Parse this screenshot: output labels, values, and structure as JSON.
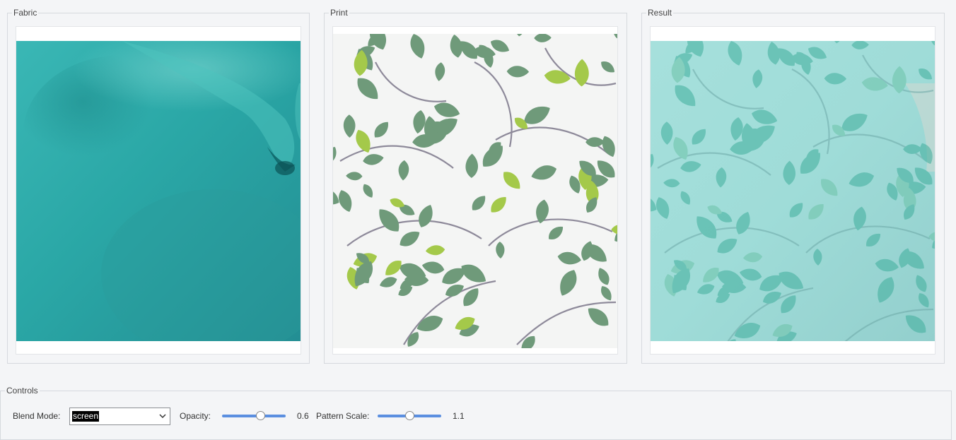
{
  "panels": {
    "fabric": {
      "title": "Fabric"
    },
    "print": {
      "title": "Print"
    },
    "result": {
      "title": "Result"
    }
  },
  "controls": {
    "title": "Controls",
    "blend_mode_label": "Blend Mode:",
    "blend_mode_value": "screen",
    "opacity_label": "Opacity:",
    "opacity_value": "0.6",
    "opacity_fraction": 0.6,
    "pattern_scale_label": "Pattern Scale:",
    "pattern_scale_value": "1.1",
    "pattern_scale_fraction": 0.5
  },
  "colors": {
    "fabric": "#2aa9a8",
    "leaf_dark": "#6f9a7a",
    "leaf_light": "#a4c94a",
    "stem": "#8e8a9a",
    "slider_track": "#5b8fe0"
  }
}
